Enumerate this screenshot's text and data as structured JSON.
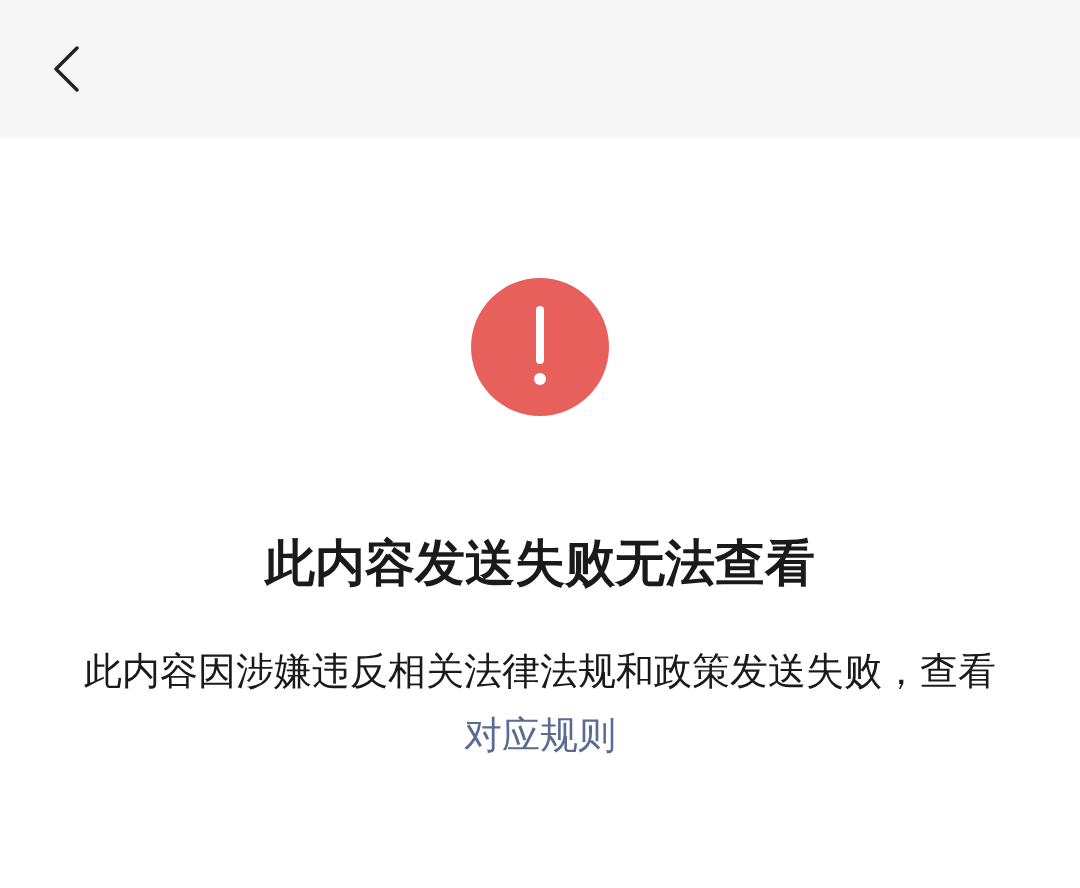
{
  "title": "此内容发送失败无法查看",
  "message": {
    "text": "此内容因涉嫌违反相关法律法规和政策发送失败，查看",
    "link": "对应规则"
  }
}
